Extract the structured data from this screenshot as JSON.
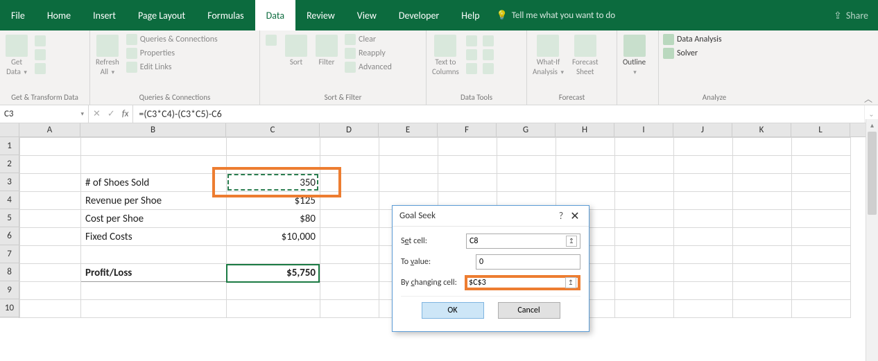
{
  "tabs": [
    "File",
    "Home",
    "Insert",
    "Page Layout",
    "Formulas",
    "Data",
    "Review",
    "View",
    "Developer",
    "Help"
  ],
  "activeTab": "Data",
  "tellMe": "Tell me what you want to do",
  "share": "Share",
  "ribbon": {
    "groups": [
      {
        "label": "Get & Transform Data",
        "buttons": [
          {
            "label": "Get\nData"
          }
        ],
        "side": [
          "",
          "",
          ""
        ]
      },
      {
        "label": "Queries & Connections",
        "buttons": [
          {
            "label": "Refresh\nAll"
          }
        ],
        "lines": [
          "Queries & Connections",
          "Properties",
          "Edit Links"
        ]
      },
      {
        "label": "Sort & Filter",
        "buttons": [
          {
            "label": "Sort"
          },
          {
            "label": "Filter"
          }
        ],
        "lines": [
          "Clear",
          "Reapply",
          "Advanced"
        ]
      },
      {
        "label": "Data Tools",
        "buttons": [
          {
            "label": "Text to\nColumns"
          }
        ]
      },
      {
        "label": "Forecast",
        "buttons": [
          {
            "label": "What-If\nAnalysis"
          },
          {
            "label": "Forecast\nSheet"
          }
        ]
      },
      {
        "label": "",
        "buttons": [
          {
            "label": "Outline"
          }
        ]
      },
      {
        "label": "Analyze",
        "lines": [
          "Data Analysis",
          "Solver"
        ]
      }
    ]
  },
  "nameBox": "C3",
  "formula": "=(C3*C4)-(C3*C5)-C6",
  "columns": [
    "A",
    "B",
    "C",
    "D",
    "E",
    "F",
    "G",
    "H",
    "I",
    "J",
    "K",
    "L"
  ],
  "rows": [
    "1",
    "2",
    "3",
    "4",
    "5",
    "6",
    "7",
    "8",
    "9",
    "10"
  ],
  "cells": {
    "r3": {
      "B": "# of Shoes Sold",
      "C": "350"
    },
    "r4": {
      "B": "Revenue per Shoe",
      "C": "$125"
    },
    "r5": {
      "B": "Cost per Shoe",
      "C": "$80"
    },
    "r6": {
      "B": "Fixed Costs",
      "C": "$10,000"
    },
    "r8": {
      "B": "Profit/Loss",
      "C": "$5,750"
    }
  },
  "dialog": {
    "title": "Goal Seek",
    "setCellLabel": "Set cell:",
    "setCellValue": "C8",
    "toValueLabel": "To value:",
    "toValueValue": "0",
    "byChangingLabel": "By changing cell:",
    "byChangingValue": "$C$3",
    "ok": "OK",
    "cancel": "Cancel"
  }
}
